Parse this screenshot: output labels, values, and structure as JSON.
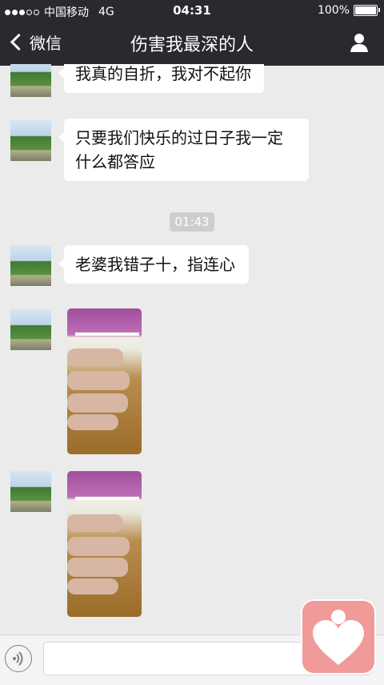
{
  "status_bar": {
    "carrier": "中国移动",
    "network": "4G",
    "time": "04:31",
    "battery": "100%"
  },
  "nav": {
    "back_label": "微信",
    "title": "伤害我最深的人"
  },
  "messages": [
    {
      "type": "text",
      "text": "我真的自折，我对不起你"
    },
    {
      "type": "text",
      "text": "只要我们快乐的过日子我一定什么都答应"
    },
    {
      "type": "time",
      "text": "01:43"
    },
    {
      "type": "text",
      "text": "老婆我错子十，指连心"
    },
    {
      "type": "image"
    },
    {
      "type": "image"
    }
  ],
  "colors": {
    "topbar": "#2a2a2e",
    "chat_bg": "#ebebeb",
    "bubble": "#ffffff",
    "badge": "#f19a9a"
  }
}
